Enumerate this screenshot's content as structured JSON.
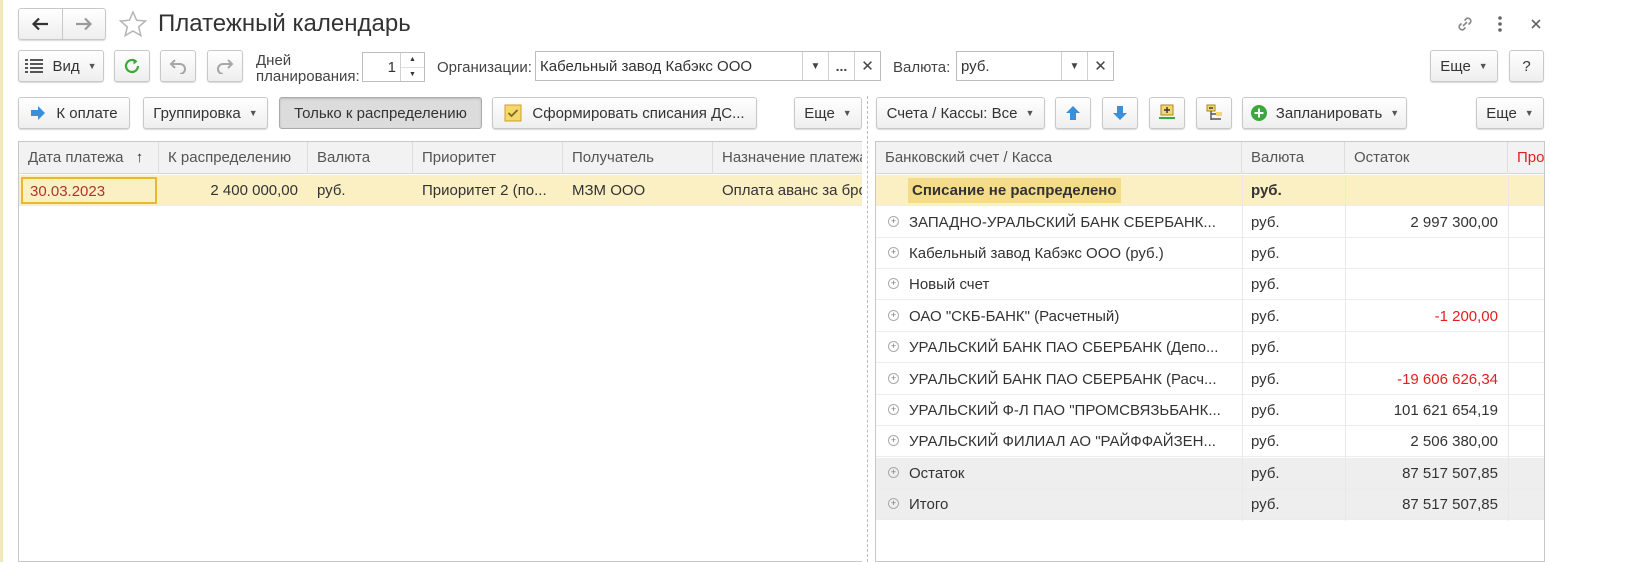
{
  "header": {
    "title": "Платежный календарь"
  },
  "toolbar1": {
    "view_label": "Вид",
    "days_label_line1": "Дней",
    "days_label_line2": "планирования:",
    "days_value": "1",
    "org_label": "Организации:",
    "org_value": "Кабельный завод Кабэкс ООО",
    "org_choose": "...",
    "currency_label": "Валюта:",
    "currency_value": "руб.",
    "more_label": "Еще",
    "help_label": "?"
  },
  "toolbar_left": {
    "to_pay_label": "К оплате",
    "grouping_label": "Группировка",
    "only_distribution_label": "Только к распределению",
    "generate_label": "Сформировать списания ДС...",
    "more_label": "Еще"
  },
  "toolbar_right": {
    "accounts_label": "Счета / Кассы: Все",
    "plan_label": "Запланировать",
    "more_label": "Еще"
  },
  "left_table": {
    "columns": [
      "Дата платежа",
      "К распределению",
      "Валюта",
      "Приоритет",
      "Получатель",
      "Назначение платежа"
    ],
    "rows": [
      [
        "30.03.2023",
        "2 400 000,00",
        "руб.",
        "Приоритет 2 (по...",
        "МЗМ ООО",
        "Оплата аванс за бро"
      ]
    ]
  },
  "right_table": {
    "columns": [
      "Банковский счет / Касса",
      "Валюта",
      "Остаток",
      "Про"
    ],
    "rows": [
      {
        "name": "Списание не распределено",
        "currency": "руб.",
        "balance": ""
      },
      {
        "name": "ЗАПАДНО-УРАЛЬСКИЙ БАНК СБЕРБАНК...",
        "currency": "руб.",
        "balance": "2 997 300,00"
      },
      {
        "name": "Кабельный завод Кабэкс ООО (руб.)",
        "currency": "руб.",
        "balance": ""
      },
      {
        "name": "Новый счет",
        "currency": "руб.",
        "balance": ""
      },
      {
        "name": "ОАО \"СКБ-БАНК\" (Расчетный)",
        "currency": "руб.",
        "balance": "-1 200,00"
      },
      {
        "name": "УРАЛЬСКИЙ БАНК ПАО СБЕРБАНК (Депо...",
        "currency": "руб.",
        "balance": ""
      },
      {
        "name": "УРАЛЬСКИЙ БАНК ПАО СБЕРБАНК (Расч...",
        "currency": "руб.",
        "balance": "-19 606 626,34"
      },
      {
        "name": "УРАЛЬСКИЙ Ф-Л ПАО \"ПРОМСВЯЗЬБАНК...",
        "currency": "руб.",
        "balance": "101 621 654,19"
      },
      {
        "name": "УРАЛЬСКИЙ ФИЛИАЛ АО \"РАЙФФАЙЗЕН...",
        "currency": "руб.",
        "balance": "2 506 380,00"
      },
      {
        "name": "Остаток",
        "currency": "руб.",
        "balance": "87 517 507,85"
      },
      {
        "name": "Итого",
        "currency": "руб.",
        "balance": "87 517 507,85"
      }
    ]
  },
  "colors": {
    "accent_green": "#3aa83a",
    "accent_blue": "#3a8fd9",
    "selected_row": "#fbf0c4",
    "negative": "#e02020",
    "highlight_label": "#f5dc8a"
  }
}
